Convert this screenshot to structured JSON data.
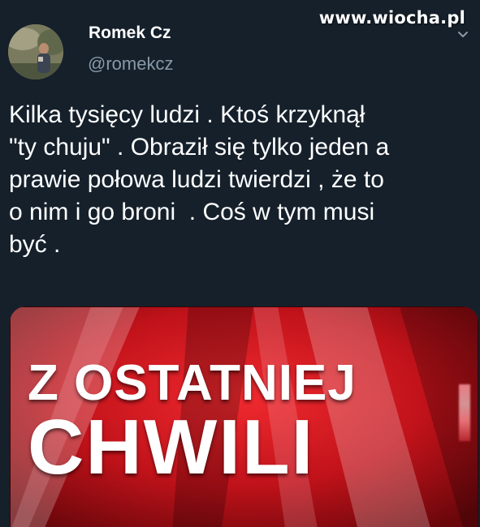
{
  "header": {
    "author_name": "Romek Cz",
    "author_handle": "@romekcz",
    "watermark": "www.wiocha.pl"
  },
  "tweet": {
    "text": "Kilka tysięcy ludzi . Ktoś krzyknął\n\"ty chuju\" . Obraził się tylko jeden a\nprawie połowa ludzi twierdzi , że to\no nim i go broni  . Coś w tym musi\nbyć ."
  },
  "media": {
    "line1": "Z OSTATNIEJ",
    "line2": "CHWILI"
  },
  "icons": {
    "menu": "chevron-down-icon"
  },
  "colors": {
    "background": "#15202b",
    "text": "#ffffff",
    "secondary_text": "#8899a6",
    "banner_red": "#d5141c"
  }
}
